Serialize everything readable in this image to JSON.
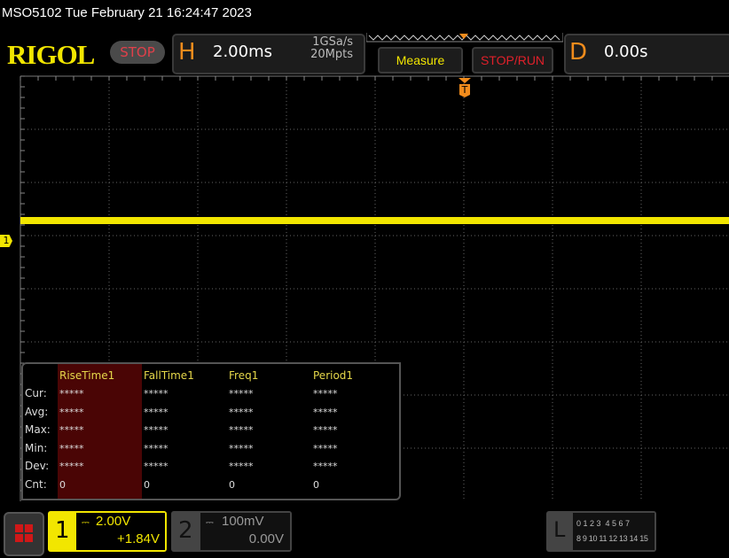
{
  "titlebar": {
    "text": "MSO5102  Tue February 21 16:24:47 2023"
  },
  "logo": "RIGOL",
  "run_state": "STOP",
  "horizontal": {
    "letter": "H",
    "timebase": "2.00ms",
    "sample_rate": "1GSa/s",
    "memory_depth": "20Mpts"
  },
  "buttons": {
    "measure": "Measure",
    "stop_run": "STOP/RUN"
  },
  "delay": {
    "letter": "D",
    "value": "0.00s"
  },
  "trigger_marker": "T",
  "colors": {
    "ch1": "#f2e600",
    "accent_orange": "#f28c1c",
    "stop_red": "#e0404a",
    "highlight": "#4a0505"
  },
  "measurements": {
    "headers": [
      "RiseTime1",
      "FallTime1",
      "Freq1",
      "Period1"
    ],
    "rows": [
      {
        "label": "Cur:",
        "values": [
          "*****",
          "*****",
          "*****",
          "*****"
        ]
      },
      {
        "label": "Avg:",
        "values": [
          "*****",
          "*****",
          "*****",
          "*****"
        ]
      },
      {
        "label": "Max:",
        "values": [
          "*****",
          "*****",
          "*****",
          "*****"
        ]
      },
      {
        "label": "Min:",
        "values": [
          "*****",
          "*****",
          "*****",
          "*****"
        ]
      },
      {
        "label": "Dev:",
        "values": [
          "*****",
          "*****",
          "*****",
          "*****"
        ]
      },
      {
        "label": "Cnt:",
        "values": [
          "0",
          "0",
          "0",
          "0"
        ]
      }
    ]
  },
  "channel1": {
    "number": "1",
    "scale": "2.00V",
    "offset": "+1.84V",
    "coupling_icon": "dc-coupling-icon"
  },
  "channel2": {
    "number": "2",
    "scale": "100mV",
    "offset": "0.00V",
    "coupling_icon": "dc-coupling-icon"
  },
  "logic": {
    "letter": "L",
    "row1": "0 1 2 3  4 5 6 7",
    "row2": "8 9 10 11 12 13 14 15"
  }
}
